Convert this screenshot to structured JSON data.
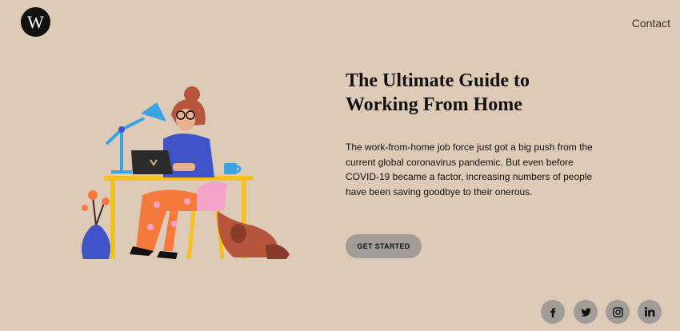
{
  "brand": {
    "logo_letter": "W"
  },
  "nav": {
    "contact_label": "Contact"
  },
  "hero": {
    "title_line1": "The Ultimate Guide to",
    "title_line2": "Working From Home",
    "body": "The work-from-home job force just got a big push from the current global coronavirus pandemic. But even before COVID-19 became a factor, increasing numbers of people have been saving goodbye to their onerous.",
    "cta_label": "GET STARTED"
  },
  "social": [
    {
      "icon": "facebook-icon"
    },
    {
      "icon": "twitter-icon"
    },
    {
      "icon": "instagram-icon"
    },
    {
      "icon": "linkedin-icon"
    }
  ],
  "colors": {
    "background": "#decbb7",
    "button": "#a39c96",
    "text": "#111111",
    "logo": "#111111"
  }
}
